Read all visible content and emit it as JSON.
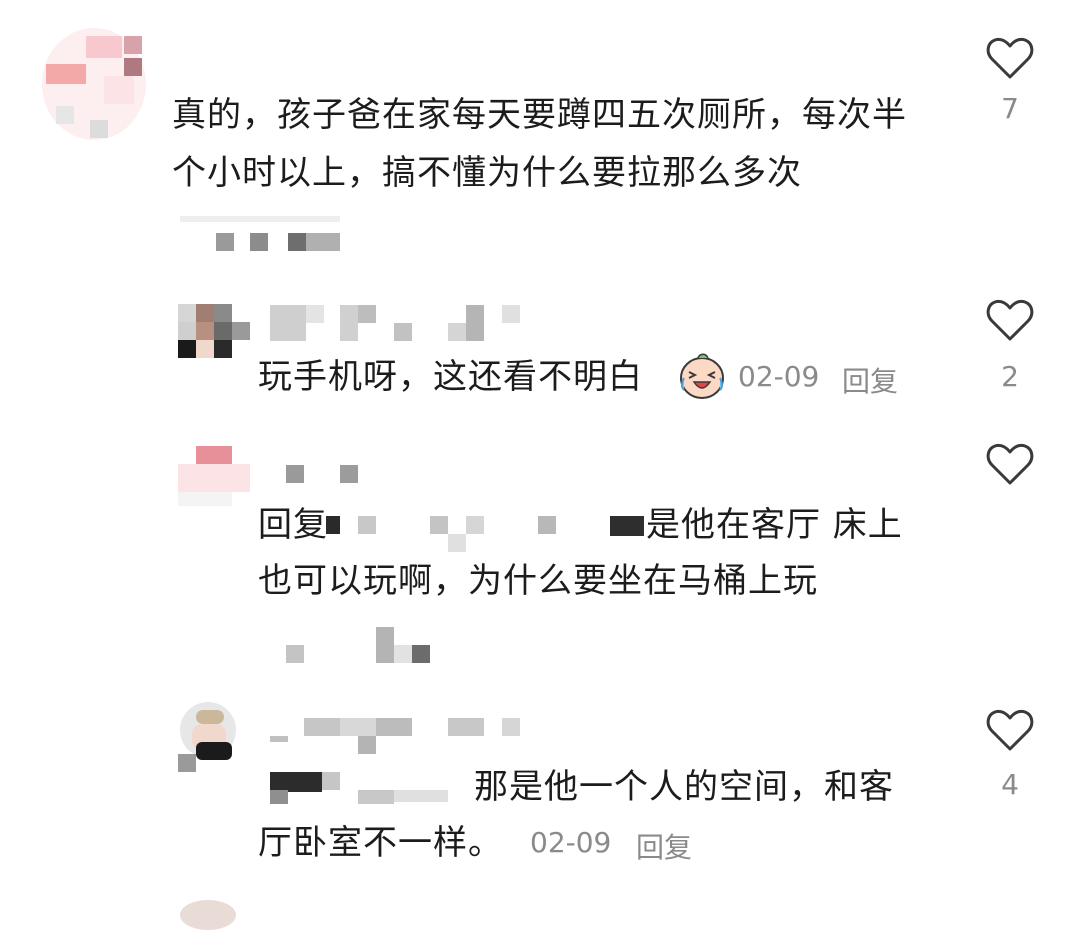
{
  "comments": [
    {
      "text": "真的，孩子爸在家每天要蹲四五次厕所，每次半个小时以上，搞不懂为什么要拉那么多次",
      "likes": "7"
    },
    {
      "text": "玩手机呀，这还看不明白",
      "emoji_icon": "laughing-crying-face-icon",
      "time": "02-09",
      "reply": "回复",
      "likes": "2"
    },
    {
      "prefix": "回复",
      "text_tail": "是他在客厅 床上",
      "text_line2": "也可以玩啊，为什么要坐在马桶上玩",
      "likes": ""
    },
    {
      "text": "那是他一个人的空间，和客",
      "text_line2": "厅卧室不一样。",
      "time": "02-09",
      "reply": "回复",
      "likes": "4"
    }
  ],
  "colors": {
    "text": "#1c1c1c",
    "meta": "#8a8a8a",
    "heart": "#3a3a3a",
    "mosaic_gray": "#c8c8c8"
  },
  "icons": {
    "like": "heart-outline-icon"
  }
}
